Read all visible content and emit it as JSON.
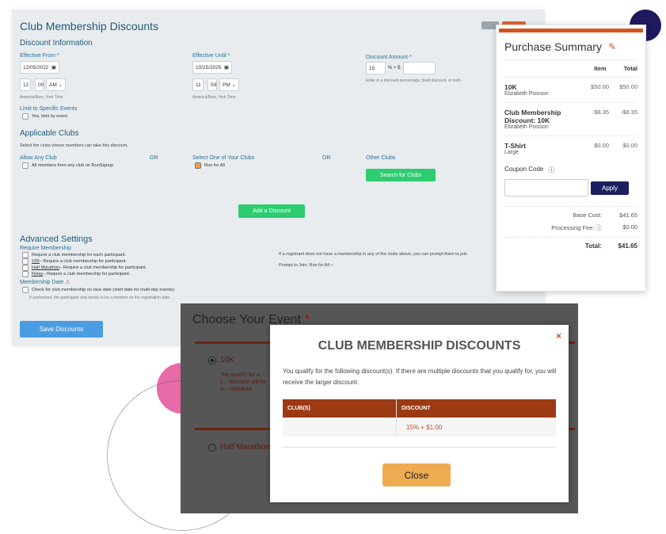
{
  "admin": {
    "title": "Club Membership Discounts",
    "discount_info": "Discount Information",
    "effective_from_label": "Effective From *",
    "effective_from_date": "12/05/2022",
    "from_hour": "12",
    "from_min": "00",
    "from_ampm": "AM",
    "effective_until_label": "Effective Until *",
    "effective_until_date": "10/15/2025",
    "until_hour": "11",
    "until_min": "59",
    "until_ampm": "PM",
    "timezone": "America/New_York Time",
    "discount_amount_label": "Discount Amount *",
    "discount_percent": "15",
    "discount_sep": "% + $",
    "discount_fixed": "",
    "discount_help": "Enter in a discount percentage, fixed discount, or both.",
    "limit_label": "Limit to Specific Events",
    "limit_option": "Yes, limit by event.",
    "applicable_clubs": "Applicable Clubs",
    "clubs_help": "Select the clubs whose members can take this discount.",
    "any_club": "Allow Any Club",
    "any_club_option": "All members from any club on RunSignup",
    "or": "OR",
    "your_clubs": "Select One of Your Clubs",
    "your_club_option": "Run for All",
    "other_clubs": "Other Clubs",
    "search_clubs": "Search for Clubs",
    "add_discount": "Add a Discount",
    "advanced": "Advanced Settings",
    "require_membership": "Require Membership",
    "req_options": [
      {
        "link": "",
        "text": "Require a club membership for each participant."
      },
      {
        "link": "10K",
        "text": " – Require a club membership for participant."
      },
      {
        "link": "Half Marathon",
        "text": " – Require a club membership for participant."
      },
      {
        "link": "Relay",
        "text": " – Require a club membership for participant."
      }
    ],
    "membership_date": "Membership Date",
    "race_date_option": "Check for club membership on race date (start date for multi-day events).",
    "race_date_help": "If unchecked, the participant only needs to be a member on the registration date.",
    "prompt_help": "If a registrant does not have a membership in any of the clubs above, you can prompt them to join",
    "prompt_join": "Prompt to Join: Run for All",
    "prompt_remove": "×",
    "save": "Save Discounts"
  },
  "summary": {
    "title": "Purchase Summary",
    "col_item": "Item",
    "col_total": "Total",
    "items": [
      {
        "name": "10K",
        "sub": "Elizabeth Poisson",
        "item": "$50.00",
        "total": "$50.00"
      },
      {
        "name": "Club Membership Discount: 10K",
        "sub": "Elizabeth Poisson",
        "item": "-$8.35",
        "total": "-$8.35"
      },
      {
        "name": "T-Shirt",
        "sub": "Large",
        "item": "$0.00",
        "total": "$0.00"
      }
    ],
    "coupon_label": "Coupon Code",
    "coupon_value": "",
    "apply": "Apply",
    "base_cost_label": "Base Cost:",
    "base_cost": "$41.65",
    "fee_label": "Processing Fee:",
    "fee": "$0.00",
    "total_label": "Total:",
    "total": "$41.65"
  },
  "event": {
    "title": "Choose Your Event",
    "req": "*",
    "options": [
      "10K",
      "Half Marathon"
    ],
    "qualify_text": "You qualify for a c... discount will be a... checkout"
  },
  "modal": {
    "title": "CLUB MEMBERSHIP DISCOUNTS",
    "text": "You qualify for the following discount(s). If there are multiple discounts that you qualify for, you will receive the larger discount.",
    "col_clubs": "CLUB(S)",
    "col_discount": "DISCOUNT",
    "row_club": "",
    "row_discount": "15% + $1.00",
    "close": "Close",
    "close_x": "×"
  },
  "colors": {
    "accent": "#1f5a78",
    "green": "#2ecc71",
    "brand_orange": "#c94f1f",
    "table_header": "#9c3a14",
    "close_button": "#eeab51",
    "apply": "#1c1f5e",
    "navy_circle": "#1e1a5c",
    "pink_circle": "#e86aa8"
  }
}
